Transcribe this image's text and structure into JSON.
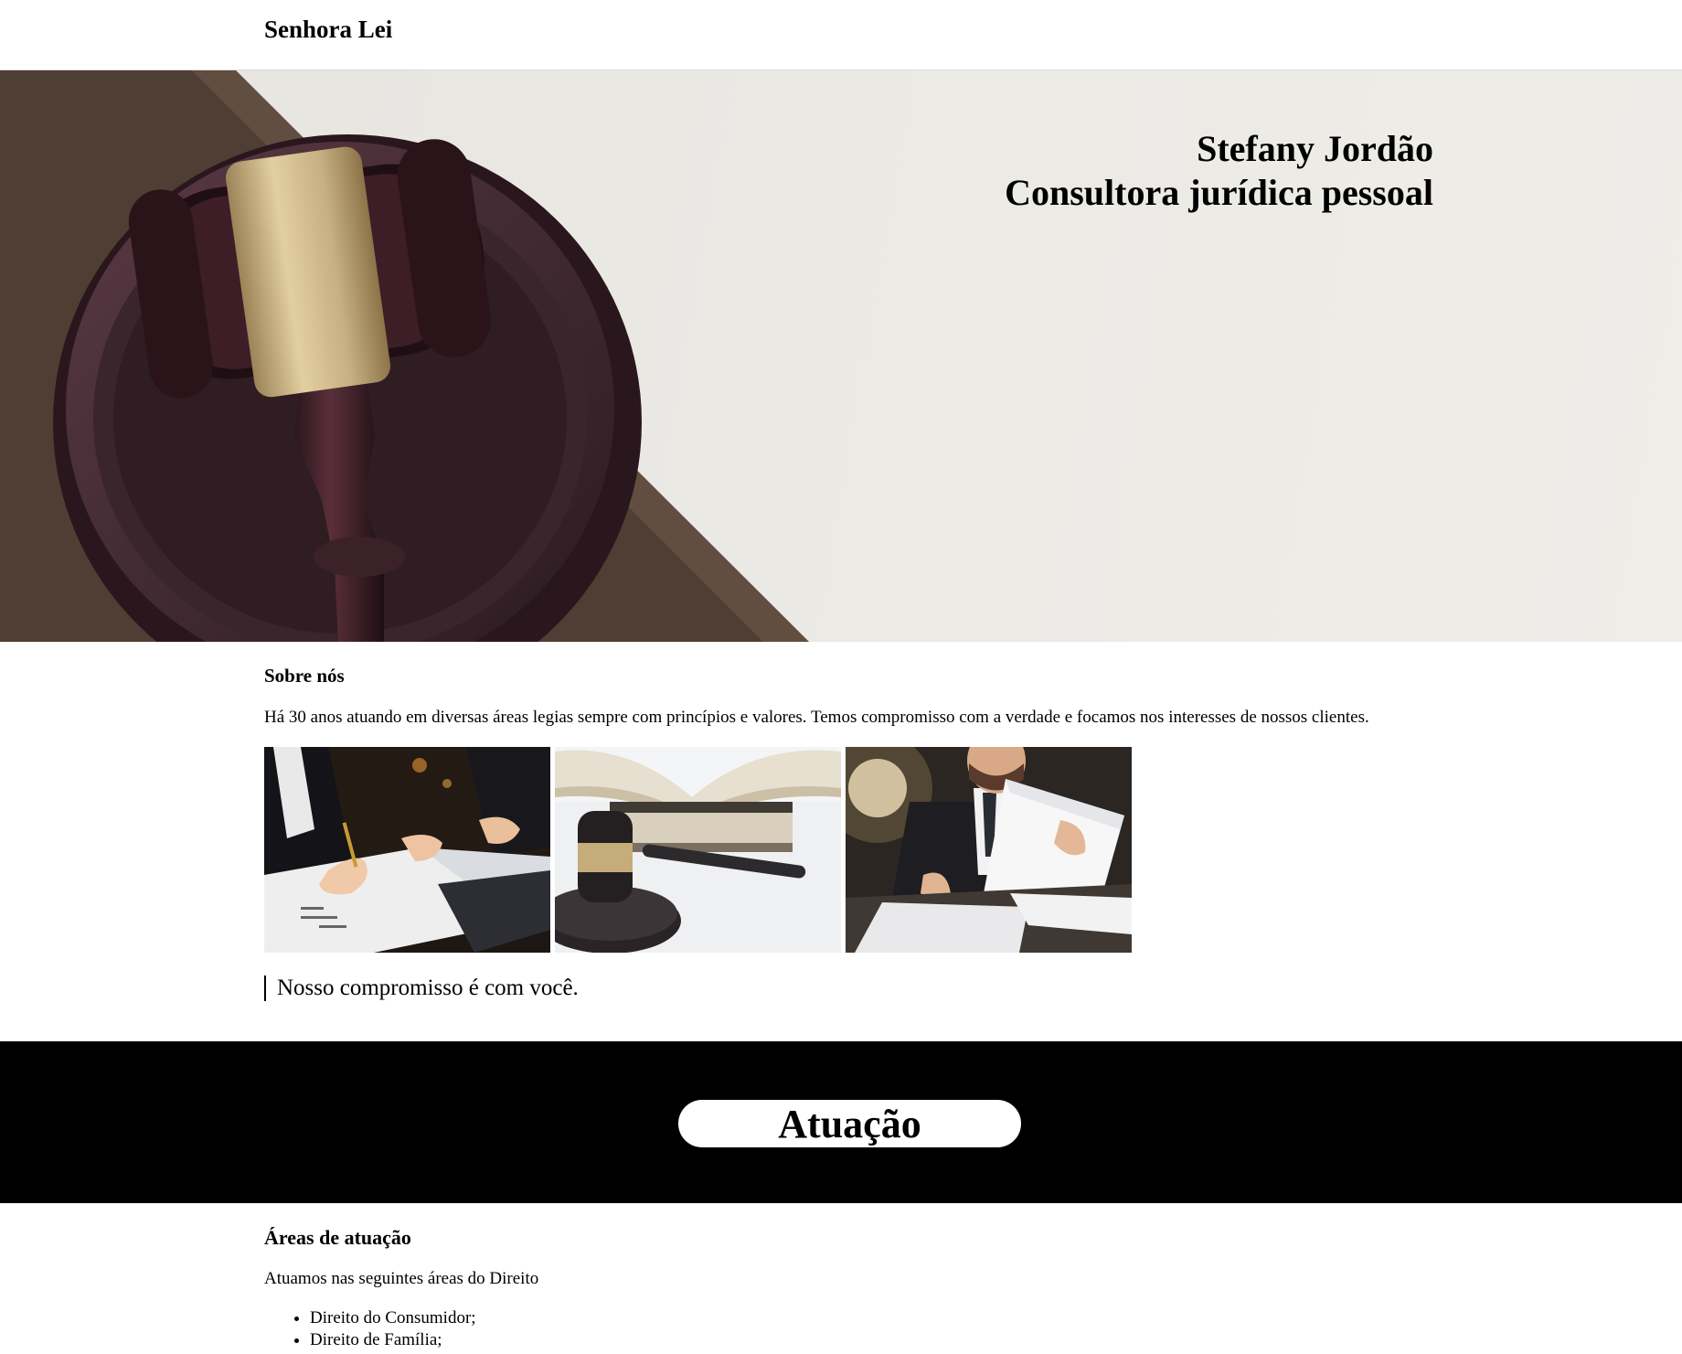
{
  "header": {
    "brand": "Senhora Lei"
  },
  "hero": {
    "line1": "Stefany Jordão",
    "line2": "Consultora jurídica pessoal",
    "image": "gavel-on-sound-block-photo"
  },
  "about": {
    "heading": "Sobre nós",
    "text": "Há 30 anos atuando em diversas áreas legias sempre com princípios e valores. Temos compromisso com a verdade e focamos nos interesses de nossos clientes.",
    "photos": [
      "signing-contract-photo",
      "gavel-and-books-photo",
      "man-reading-document-photo"
    ],
    "quote": "Nosso compromisso é com você."
  },
  "band": {
    "title": "Atuação"
  },
  "areas": {
    "heading": "Áreas de atuação",
    "intro": "Atuamos nas seguintes áreas do Direito",
    "items": [
      "Direito do Consumidor;",
      "Direito de Família;"
    ]
  },
  "colors": {
    "band": "#000000",
    "pill": "#ffffff",
    "text": "#000000"
  }
}
